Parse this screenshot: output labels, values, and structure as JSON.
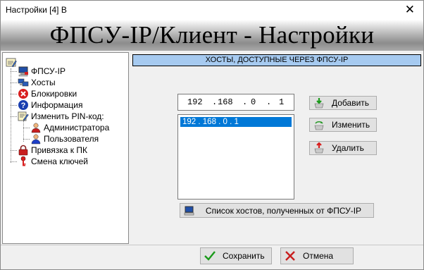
{
  "window": {
    "title": "Настройки [4] В",
    "close_glyph": "✕"
  },
  "banner": {
    "text": "ФПСУ-IP/Клиент - Настройки"
  },
  "tree": {
    "items": [
      {
        "label": "ФПСУ-IP",
        "icon": "computer-icon"
      },
      {
        "label": "Хосты",
        "icon": "hosts-icon"
      },
      {
        "label": "Блокировки",
        "icon": "block-icon"
      },
      {
        "label": "Информация",
        "icon": "info-icon"
      },
      {
        "label": "Изменить PIN-код:",
        "icon": "edit-icon"
      },
      {
        "label": "Администратора",
        "icon": "admin-user-icon"
      },
      {
        "label": "Пользователя",
        "icon": "user-icon"
      },
      {
        "label": "Привязка к ПК",
        "icon": "lock-icon"
      },
      {
        "label": "Смена ключей",
        "icon": "key-icon"
      }
    ]
  },
  "panel": {
    "header": "ХОСТЫ, ДОСТУПНЫЕ ЧЕРЕЗ ФПСУ-IP",
    "ip": {
      "o1": "192",
      "d1": ".",
      "o2": "168",
      "d2": ".",
      "o3": "0",
      "d3": ".",
      "o4": "1"
    },
    "hosts": [
      "192 . 168 . 0 . 1"
    ],
    "add_label": "Добавить",
    "edit_label": "Изменить",
    "delete_label": "Удалить",
    "list_hosts_label": "Список хостов, полученных от ФПСУ-IP"
  },
  "footer": {
    "save_label": "Сохранить",
    "cancel_label": "Отмена"
  },
  "colors": {
    "header_bg": "#a6caf0",
    "selection": "#0078d7",
    "button_bg": "#e1e1e1"
  }
}
